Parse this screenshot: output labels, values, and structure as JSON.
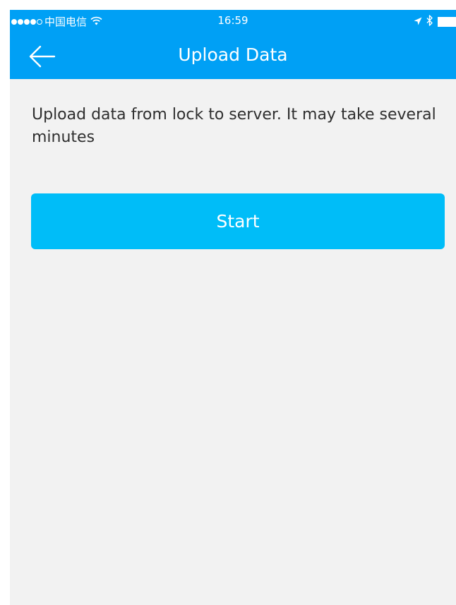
{
  "status_bar": {
    "signal_dots_filled": 4,
    "signal_dots_total": 5,
    "carrier": "中国电信",
    "time": "16:59",
    "wifi_icon": "wifi-icon",
    "location_icon": "location-arrow-icon",
    "bluetooth_icon": "bluetooth-icon",
    "battery_icon": "battery-icon"
  },
  "nav": {
    "back_icon": "arrow-left-icon",
    "title": "Upload Data"
  },
  "main": {
    "description": "Upload data from lock to server. It may take several minutes",
    "start_label": "Start"
  },
  "colors": {
    "nav_background": "#00a0f5",
    "button_background": "#00bdf8",
    "page_background": "#f2f2f2",
    "text_color": "#2f2f2f"
  }
}
